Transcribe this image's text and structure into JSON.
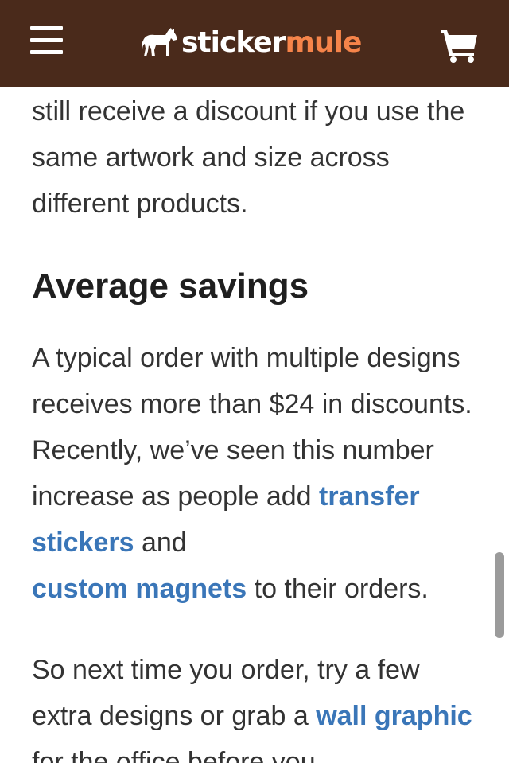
{
  "header": {
    "logo": {
      "part1": "sticker",
      "part2": "mule"
    },
    "menu_icon": "hamburger-menu-icon",
    "cart_icon": "shopping-cart-icon",
    "colors": {
      "background": "#4a2a1b",
      "logo_accent": "#f6844a",
      "link": "#3a76b8"
    }
  },
  "article": {
    "intro_paragraph": "still receive a discount if you use the same artwork and size across different products.",
    "heading": "Average savings",
    "paragraph2": {
      "text_before": "A typical order with multiple designs receives more than $24 in discounts. Recently, we’ve seen this number increase as people add ",
      "link1": "transfer stickers",
      "text_middle": " and ",
      "link2": "custom magnets",
      "text_after": " to their orders."
    },
    "paragraph3": {
      "text_before": "So next time you order, try a few extra designs or grab a ",
      "link": "wall graphic",
      "text_after": " for the office before you"
    }
  }
}
